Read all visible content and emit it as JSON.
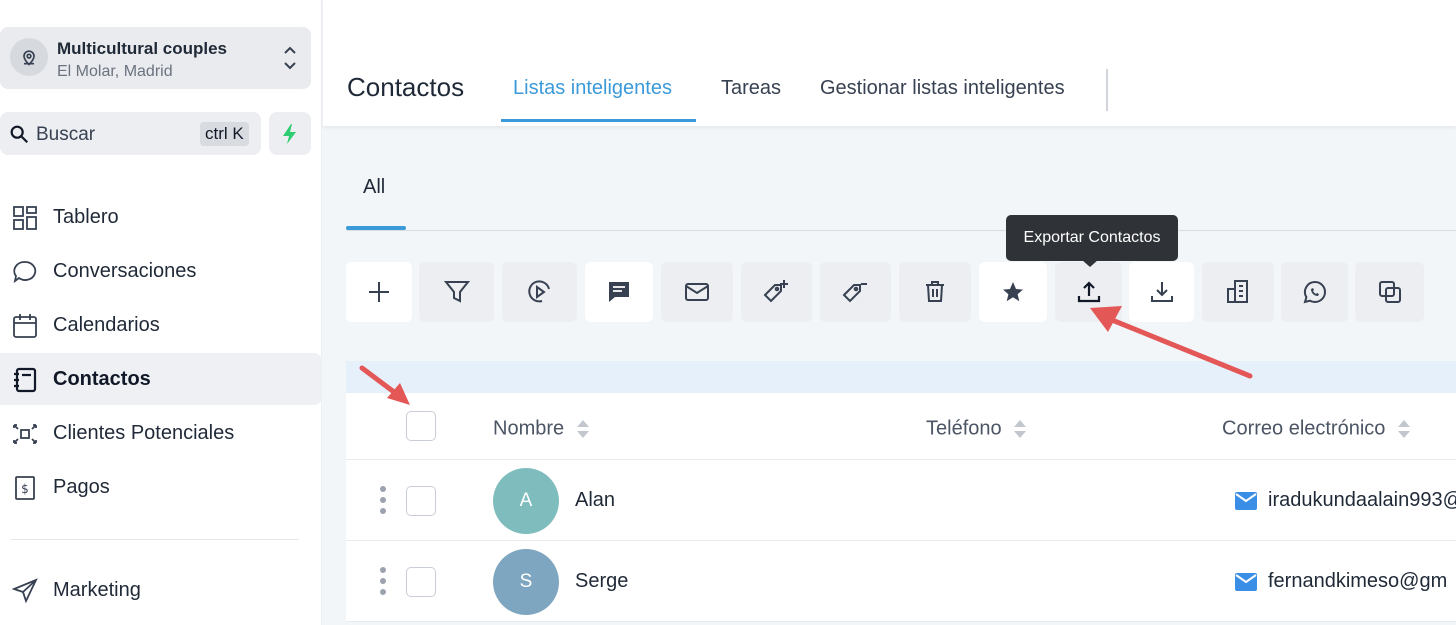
{
  "account": {
    "name": "Multicultural couples",
    "location": "El Molar, Madrid"
  },
  "search": {
    "label": "Buscar",
    "shortcut": "ctrl K"
  },
  "sidebar": {
    "items": [
      {
        "label": "Tablero",
        "icon": "dashboard-icon"
      },
      {
        "label": "Conversaciones",
        "icon": "chat-bubble-icon"
      },
      {
        "label": "Calendarios",
        "icon": "calendar-icon"
      },
      {
        "label": "Contactos",
        "icon": "contacts-book-icon",
        "active": true
      },
      {
        "label": "Clientes Potenciales",
        "icon": "opportunities-icon"
      },
      {
        "label": "Pagos",
        "icon": "payments-icon"
      },
      {
        "label": "Marketing",
        "icon": "paper-plane-icon"
      }
    ]
  },
  "header": {
    "title": "Contactos",
    "tabs": [
      {
        "label": "Listas inteligentes",
        "active": true
      },
      {
        "label": "Tareas"
      },
      {
        "label": "Gestionar listas inteligentes"
      }
    ]
  },
  "subtabs": {
    "all": "All"
  },
  "toolbar": {
    "tooltip": "Exportar Contactos",
    "buttons": [
      "add",
      "filter",
      "workflow",
      "sms",
      "email",
      "add-tag",
      "remove-tag",
      "delete",
      "star",
      "export",
      "import",
      "company",
      "whatsapp",
      "merge"
    ]
  },
  "table": {
    "columns": {
      "name": "Nombre",
      "phone": "Teléfono",
      "email": "Correo electrónico"
    },
    "rows": [
      {
        "initial": "A",
        "name": "Alan",
        "email": "iradukundaalain993@",
        "avatar_color": "#7fbcbe"
      },
      {
        "initial": "S",
        "name": "Serge",
        "email": "fernandkimeso@gm",
        "avatar_color": "#7fa6c0"
      }
    ]
  },
  "colors": {
    "accent": "#3b9ad9",
    "arrow": "#e45757",
    "bolt": "#2ecc71",
    "mail": "#3b8ee6"
  }
}
